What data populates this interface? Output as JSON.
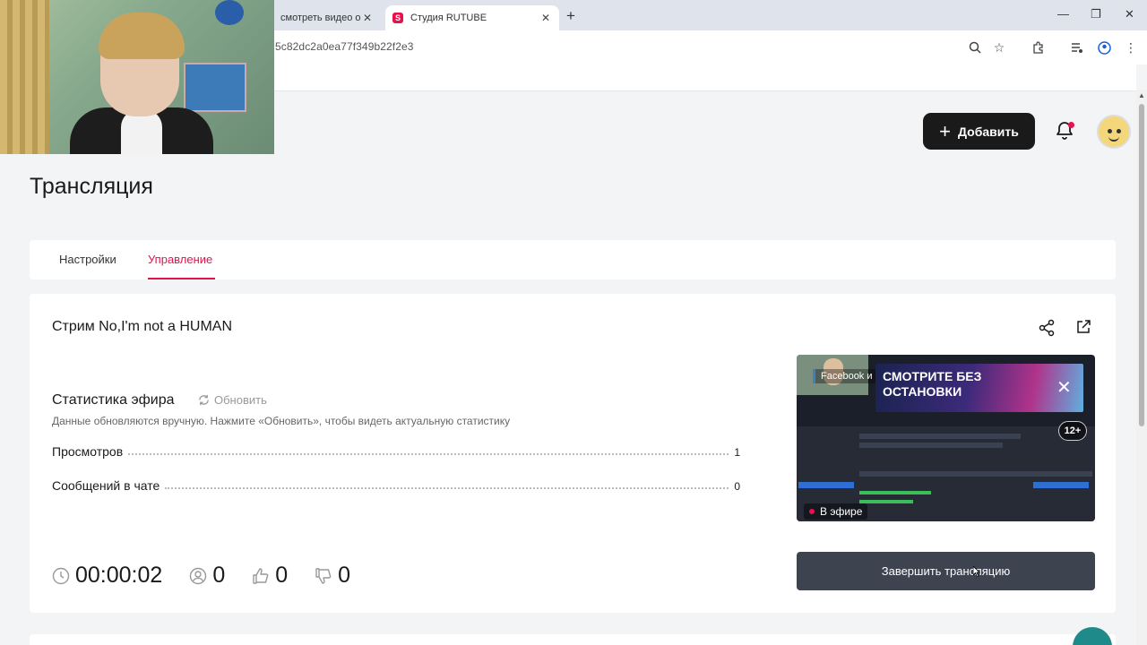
{
  "browser": {
    "tabs": [
      {
        "title": "смотреть видео онл",
        "active": false
      },
      {
        "title": "Студия RUTUBE",
        "active": true
      }
    ],
    "url": "5c82dc2a0ea77f349b22f2e3",
    "new_tab_icon": "plus-icon"
  },
  "header": {
    "add_button_label": "Добавить",
    "notifications_icon": "bell-icon",
    "accent_color": "#e8114b"
  },
  "page": {
    "title": "Трансляция",
    "tabs": [
      {
        "label": "Настройки",
        "active": false
      },
      {
        "label": "Управление",
        "active": true
      }
    ]
  },
  "stream": {
    "title": "Стрим No,I'm not a HUMAN",
    "stats": {
      "title": "Статистика эфира",
      "refresh_label": "Обновить",
      "description": "Данные обновляются вручную. Нажмите «Обновить», чтобы видеть актуальную статистику",
      "rows": [
        {
          "label": "Просмотров",
          "value": "1"
        },
        {
          "label": "Сообщений в чате",
          "value": "0"
        }
      ]
    },
    "metrics": {
      "duration": "00:00:02",
      "viewers": "0",
      "likes": "0",
      "dislikes": "0"
    },
    "preview": {
      "facebook_label": "Facebook и",
      "banner_text": "СМОТРИТЕ БЕЗ ОСТАНОВКИ",
      "age_badge": "12+",
      "live_label": "В эфире"
    },
    "end_button_label": "Завершить трансляцию"
  }
}
